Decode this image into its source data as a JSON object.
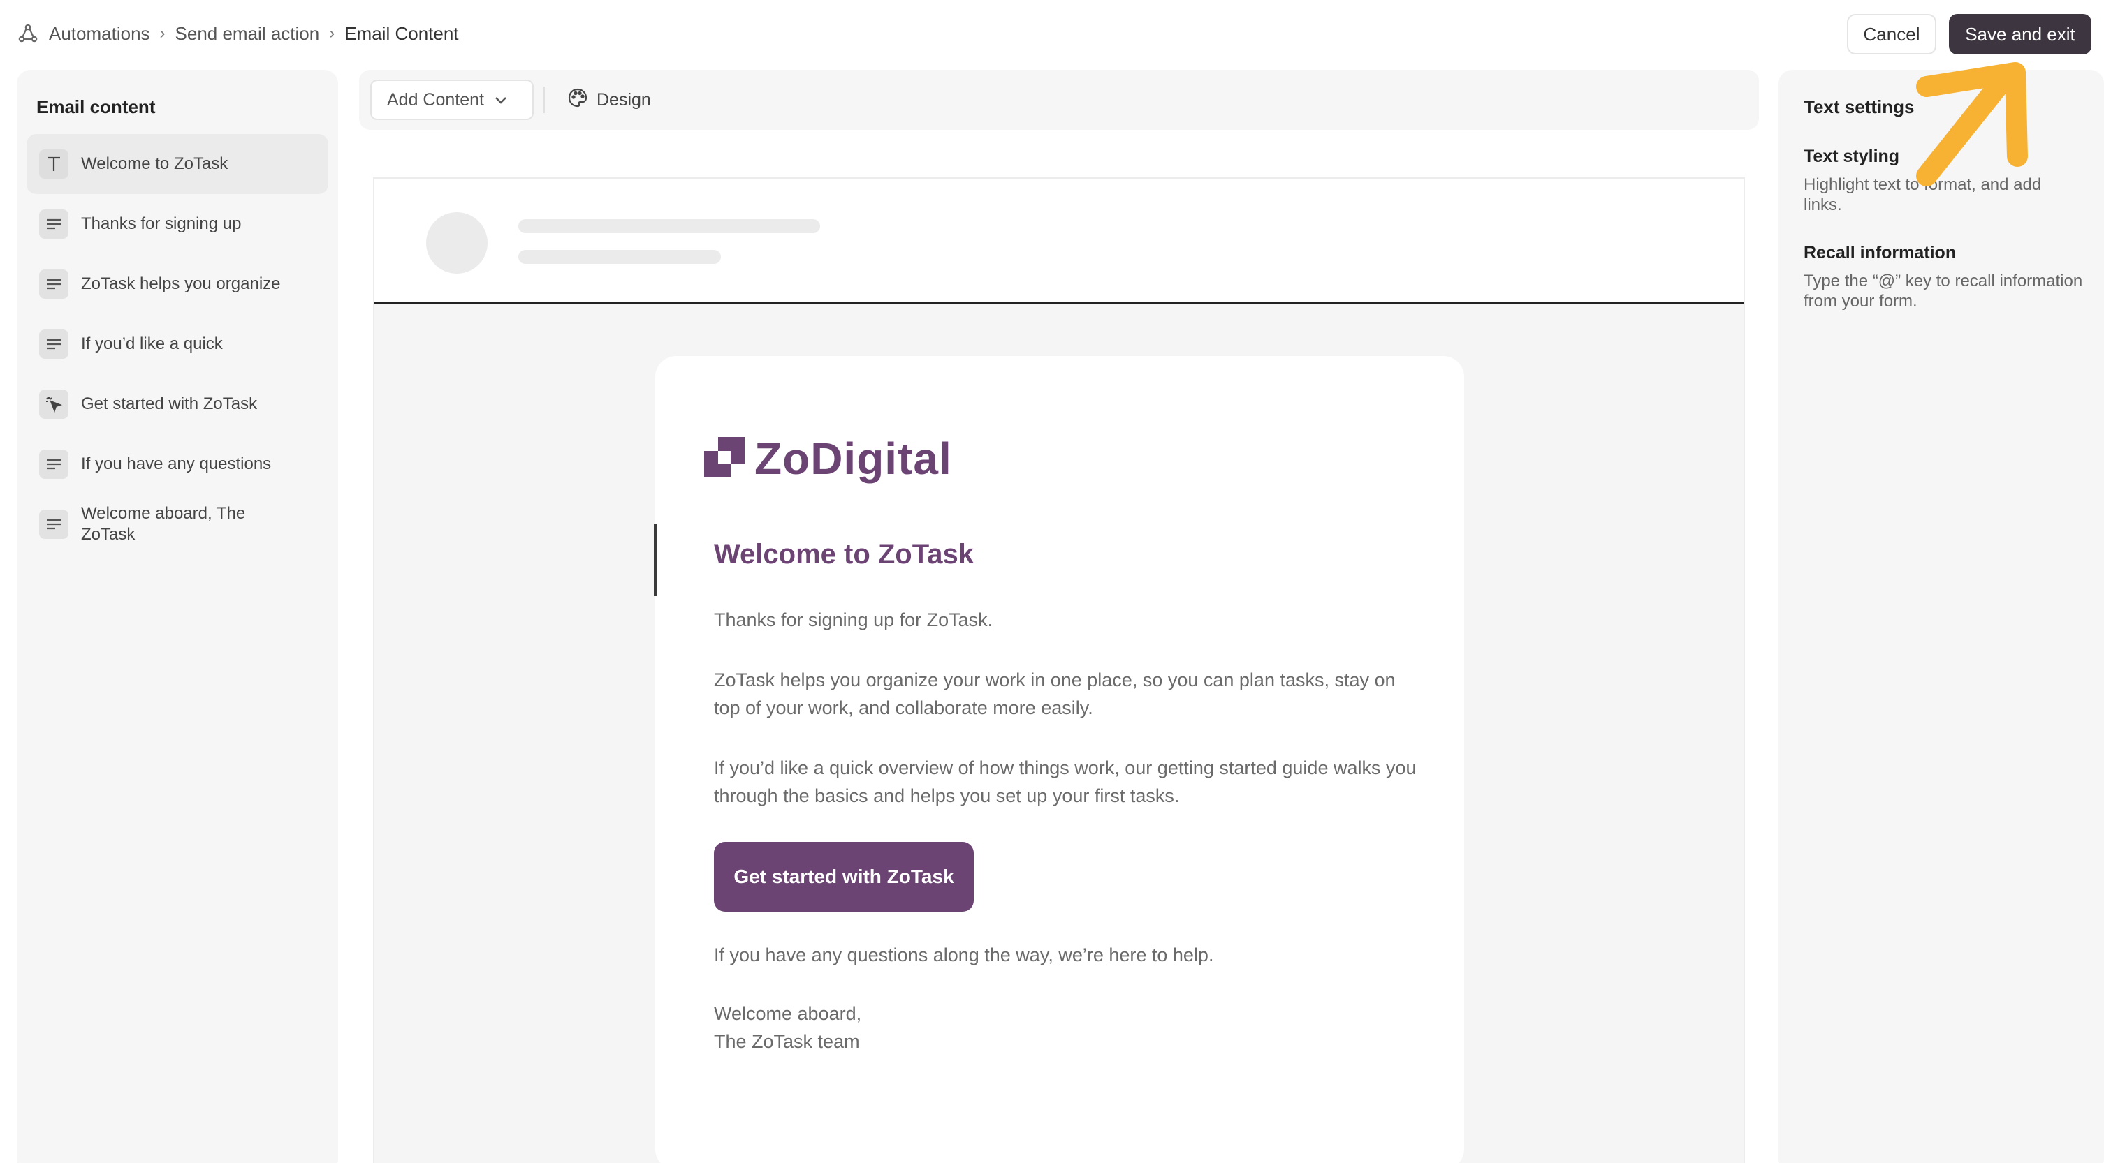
{
  "breadcrumb": {
    "items": [
      "Automations",
      "Send email action",
      "Email Content"
    ],
    "icon": "automation-icon"
  },
  "header": {
    "cancel_label": "Cancel",
    "save_label": "Save and exit"
  },
  "sidebar": {
    "title": "Email content",
    "items": [
      {
        "label": "Welcome to ZoTask",
        "icon": "heading-icon",
        "active": true
      },
      {
        "label": "Thanks for signing up",
        "icon": "paragraph-icon"
      },
      {
        "label": "ZoTask helps you organize",
        "icon": "paragraph-icon"
      },
      {
        "label": "If you’d like a quick",
        "icon": "paragraph-icon"
      },
      {
        "label": "Get started with ZoTask",
        "icon": "button-click-icon"
      },
      {
        "label": "If you have any questions",
        "icon": "paragraph-icon"
      },
      {
        "label": "Welcome aboard, The ZoTask",
        "icon": "paragraph-icon"
      }
    ]
  },
  "toolbar": {
    "add_content_label": "Add Content",
    "design_label": "Design"
  },
  "email": {
    "logo_text": "ZoDigital",
    "heading": "Welcome to ZoTask",
    "p1": "Thanks for signing up for ZoTask.",
    "p2": "ZoTask helps you organize your work in one place, so you can plan tasks, stay on top of your work, and collaborate more easily.",
    "p3": "If you’d like a quick overview of how things work, our getting started guide walks you through the basics and helps you set up your first tasks.",
    "cta_label": "Get started with ZoTask",
    "p4": "If you have any questions along the way, we’re here to help.",
    "signoff_line1": "Welcome aboard,",
    "signoff_line2": "The ZoTask team"
  },
  "right_panel": {
    "title": "Text settings",
    "sections": [
      {
        "title": "Text styling",
        "description": "Highlight text to format, and add links."
      },
      {
        "title": "Recall information",
        "description": "Type the “@” key to recall information from your form."
      }
    ]
  },
  "colors": {
    "brand": "#6c4474",
    "save_button": "#3d3540",
    "annotation_arrow": "#f7b234"
  }
}
